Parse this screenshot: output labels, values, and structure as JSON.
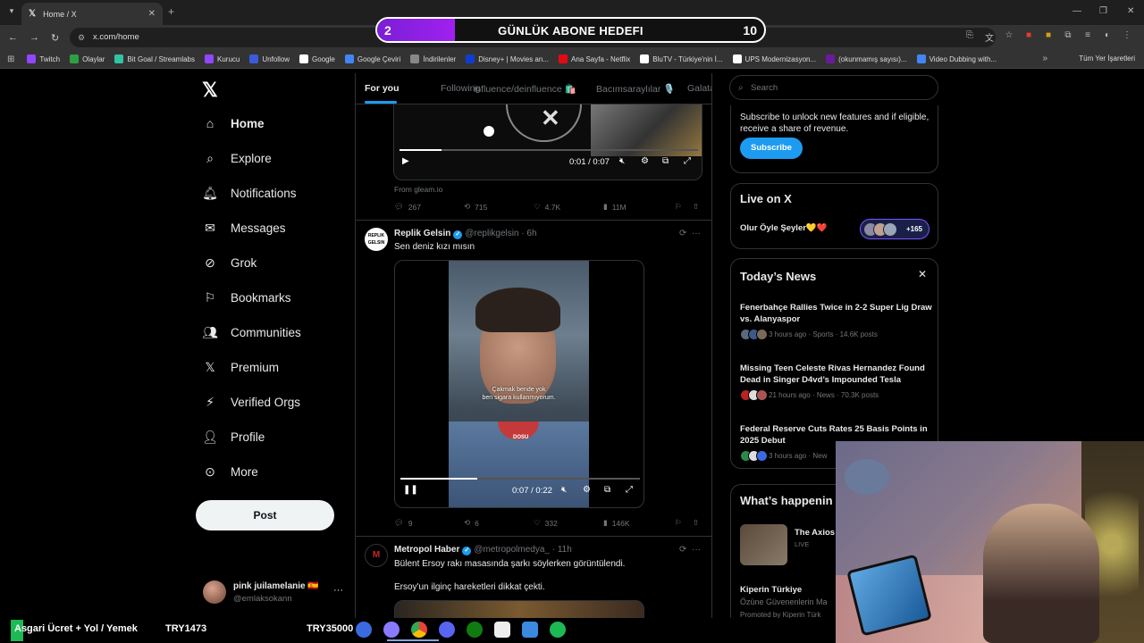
{
  "browser": {
    "tab_title": "Home / X",
    "url": "x.com/home",
    "bookmarks": [
      {
        "label": "Twitch",
        "color": "#9146ff"
      },
      {
        "label": "Olaylar",
        "color": "#2ea043"
      },
      {
        "label": "Bit Goal / Streamlabs",
        "color": "#31c3a2"
      },
      {
        "label": "Kurucu",
        "color": "#9146ff"
      },
      {
        "label": "Unfollow",
        "color": "#3b5bdb"
      },
      {
        "label": "Google",
        "color": "#ffffff"
      },
      {
        "label": "Google Çeviri",
        "color": "#4285f4"
      },
      {
        "label": "İndirilenler",
        "color": "#888888"
      },
      {
        "label": "Disney+ | Movies an...",
        "color": "#113ccf"
      },
      {
        "label": "Ana Sayfa - Netflix",
        "color": "#e50914"
      },
      {
        "label": "BluTV - Türkiye'nin İ...",
        "color": "#ffffff"
      },
      {
        "label": "UPS Modernizasyon...",
        "color": "#ffffff"
      },
      {
        "label": "(okunmamış sayısı)...",
        "color": "#6a1b9a"
      },
      {
        "label": "Video Dubbing with...",
        "color": "#4285f4"
      }
    ],
    "bookmarks_right": "Tüm Yer İşaretleri"
  },
  "goal": {
    "current": "2",
    "label": "GÜNLÜK ABONE HEDEFI",
    "target": "10",
    "progress_fraction": 0.2
  },
  "nav": {
    "items": [
      {
        "label": "Home",
        "icon": "home-icon"
      },
      {
        "label": "Explore",
        "icon": "search-icon"
      },
      {
        "label": "Notifications",
        "icon": "bell-icon"
      },
      {
        "label": "Messages",
        "icon": "mail-icon"
      },
      {
        "label": "Grok",
        "icon": "grok-icon"
      },
      {
        "label": "Bookmarks",
        "icon": "bookmark-icon"
      },
      {
        "label": "Communities",
        "icon": "communities-icon"
      },
      {
        "label": "Premium",
        "icon": "x-icon"
      },
      {
        "label": "Verified Orgs",
        "icon": "lightning-icon"
      },
      {
        "label": "Profile",
        "icon": "person-icon"
      },
      {
        "label": "More",
        "icon": "more-circle-icon"
      }
    ],
    "post_label": "Post",
    "user": {
      "name": "pink juilamelanie 🇪🇸",
      "handle": "@emlaksokann"
    }
  },
  "feed": {
    "tabs": [
      "For you",
      "Following",
      "influence/deinfluence 🛍️",
      "Bacımsaraylılar 🎙️",
      "Galata"
    ],
    "tweet1": {
      "video_time": "0:01 / 0:07",
      "video_progress": 0.14,
      "from": "From gleam.io",
      "replies": "267",
      "reposts": "715",
      "likes": "4.7K",
      "views": "11M"
    },
    "tweet2": {
      "name": "Replik Gelsin",
      "handle": "@replikgelsin · 6h",
      "text": "Sen deniz kızı mısın",
      "subtitle_line1": "Çakmak bende yok",
      "subtitle_line2": "ben sigara kullanmıyorum.",
      "watermark": "DOSU",
      "video_time": "0:07 / 0:22",
      "video_progress": 0.32,
      "replies": "9",
      "reposts": "6",
      "likes": "332",
      "views": "146K"
    },
    "tweet3": {
      "name": "Metropol Haber",
      "handle": "@metropolmedya_ · 11h",
      "text1": "Bülent Ersoy rakı masasında şarkı söylerken görüntülendi.",
      "text2": "Ersoy'un ilginç hareketleri dikkat çekti."
    }
  },
  "right": {
    "search_placeholder": "Search",
    "subscribe_text": "Subscribe to unlock new features and if eligible, receive a share of revenue.",
    "subscribe_label": "Subscribe",
    "live_title": "Live on X",
    "live_item": "Olur Öyle Şeyler💛❤️",
    "live_count": "+165",
    "news_title": "Today’s News",
    "news": [
      {
        "headline": "Fenerbahçe Rallies Twice in 2-2 Super Lig Draw vs. Alanyaspor",
        "meta": "3 hours ago · Sports · 14.6K posts"
      },
      {
        "headline": "Missing Teen Celeste Rivas Hernandez Found Dead in Singer D4vd’s Impounded Tesla",
        "meta": "21 hours ago · News · 70.3K posts"
      },
      {
        "headline": "Federal Reserve Cuts Rates 25 Basis Points in 2025 Debut",
        "meta": "3 hours ago · New"
      }
    ],
    "happening_title": "What’s happenin",
    "happening_item": "The Axios",
    "happening_sub": "LIVE",
    "promo_name": "Kiperin Türkiye",
    "promo_text": "Özüne Güvenenlerin Ma",
    "promo_by": "Promoted by Kiperin Türk"
  },
  "ticker": {
    "item1": "Asgari Ücret + Yol / Yemek",
    "item2": "TRY1473",
    "item3": "TRY35000"
  }
}
